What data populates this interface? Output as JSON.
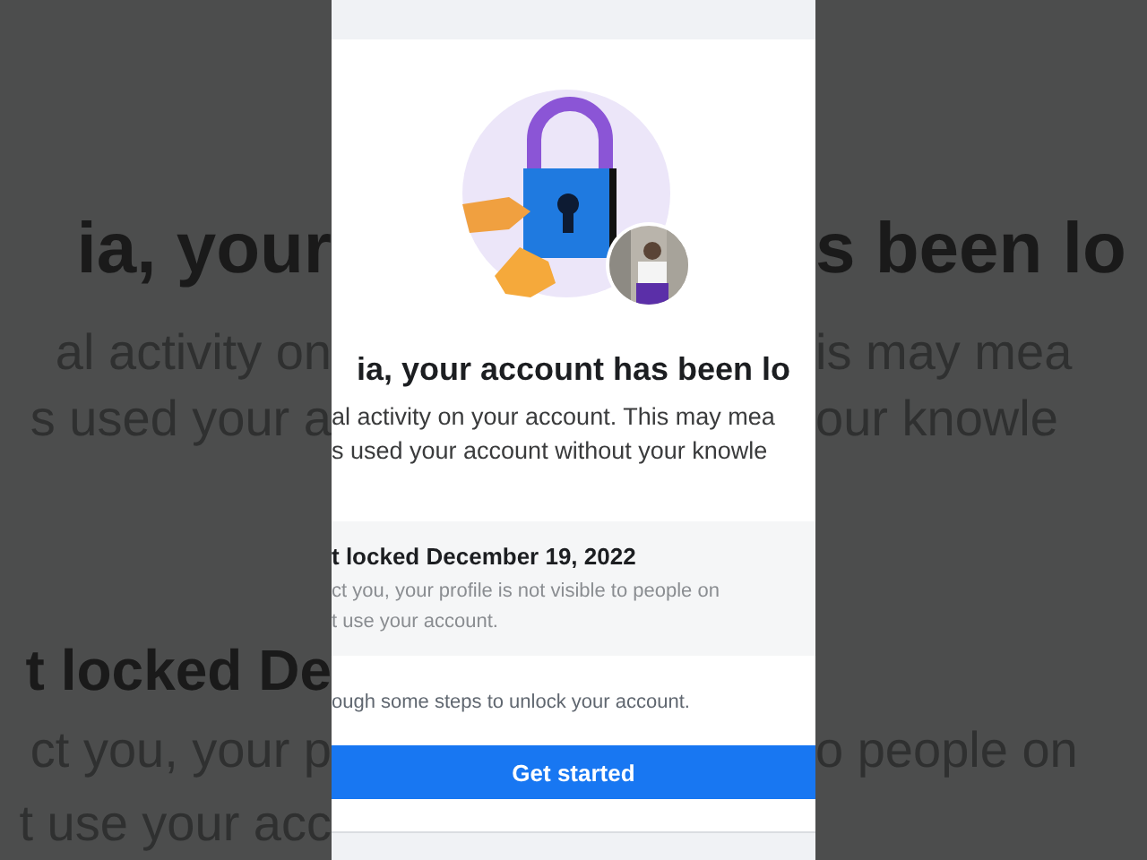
{
  "backdrop_left": [
    {
      "text": "ia, your",
      "kind": "title"
    },
    {
      "text": "al activity on",
      "kind": "body"
    },
    {
      "text": "s used your a",
      "kind": "body"
    },
    {
      "text": "t locked De",
      "kind": "heading"
    },
    {
      "text": "ct you, your p",
      "kind": "body"
    },
    {
      "text": "t use your acc",
      "kind": "body"
    }
  ],
  "backdrop_right": [
    {
      "text": "s been lo",
      "kind": "title"
    },
    {
      "text": "is may mea",
      "kind": "body"
    },
    {
      "text": "our knowle",
      "kind": "body"
    },
    {
      "text": "o people on",
      "kind": "body"
    }
  ],
  "page": {
    "title": "ia, your account has been lo",
    "body": [
      "al activity on your account. This may mea",
      "s used your account without your knowle"
    ],
    "notice": {
      "heading": "t locked December 19, 2022",
      "lines": [
        "ct you, your profile is not visible to people on",
        "t use your account."
      ]
    },
    "steps_text": "ough some steps to unlock your account.",
    "button": "Get started"
  }
}
